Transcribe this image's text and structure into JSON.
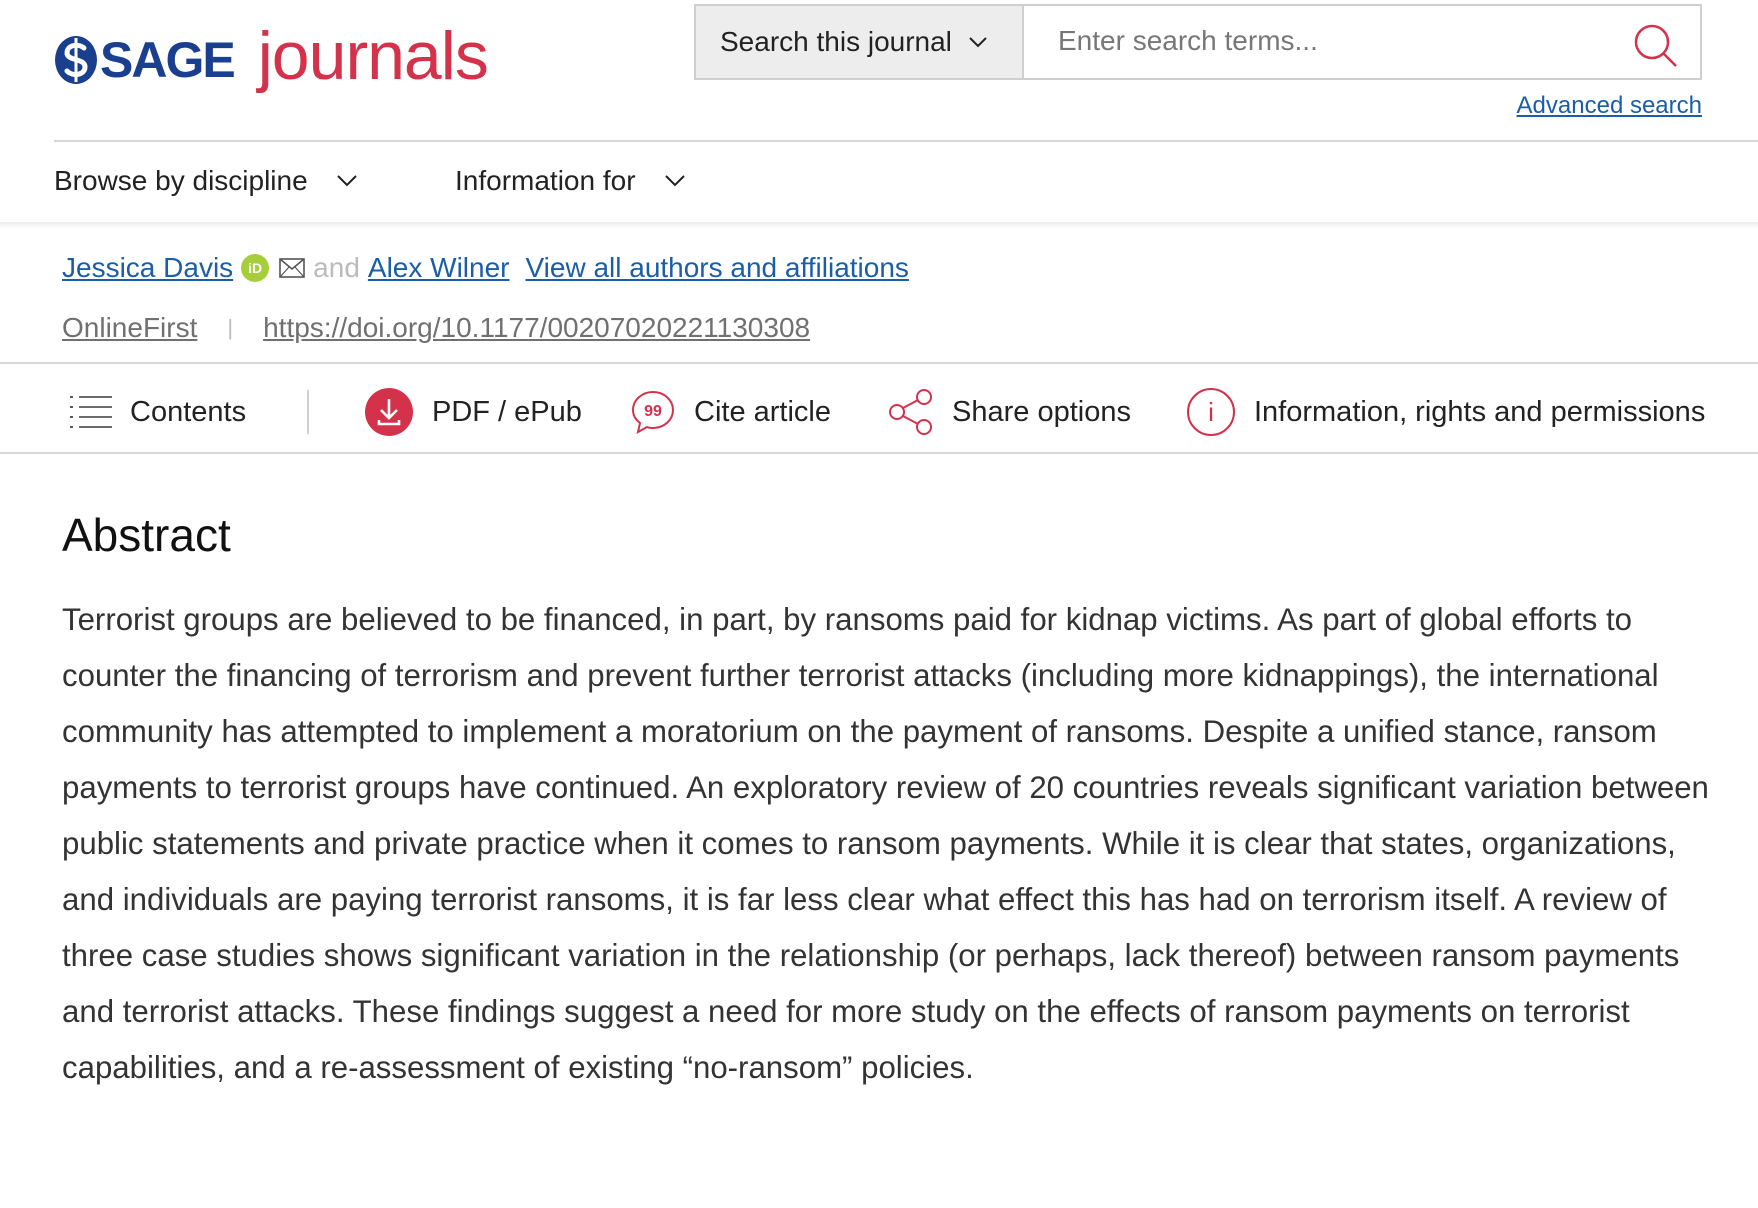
{
  "header": {
    "logo_sage": "SAGE",
    "logo_journals": "journals",
    "search_scope_label": "Search this journal",
    "search_placeholder": "Enter search terms...",
    "advanced_search": "Advanced search"
  },
  "nav": {
    "browse": "Browse by discipline",
    "info_for": "Information for"
  },
  "article": {
    "author1": "Jessica Davis",
    "orcid_label": "iD",
    "and_text": "and",
    "author2": "Alex Wilner",
    "view_all": "View all authors and affiliations",
    "status": "OnlineFirst",
    "separator": "|",
    "doi": "https://doi.org/10.1177/00207020221130308"
  },
  "toolbar": {
    "contents": "Contents",
    "pdf": "PDF / ePub",
    "cite": "Cite article",
    "share": "Share options",
    "info": "Information, rights and permissions"
  },
  "abstract": {
    "heading": "Abstract",
    "text": "Terrorist groups are believed to be financed, in part, by ransoms paid for kidnap victims. As part of global efforts to counter the financing of terrorism and prevent further terrorist attacks (including more kidnappings), the international community has attempted to implement a moratorium on the payment of ransoms. Despite a unified stance, ransom payments to terrorist groups have continued. An exploratory review of 20 countries reveals significant variation between public statements and private practice when it comes to ransom payments. While it is clear that states, organizations, and individuals are paying terrorist ransoms, it is far less clear what effect this has had on terrorism itself. A review of three case studies shows significant variation in the relationship (or perhaps, lack thereof) between ransom payments and terrorist attacks. These findings suggest a need for more study on the effects of ransom payments on terrorist capabilities, and a re-assessment of existing “no-ransom” policies."
  },
  "colors": {
    "brand_blue": "#1b3f8f",
    "brand_red": "#d4314b",
    "link_blue": "#1a5ea8",
    "orcid_green": "#a6ce39"
  }
}
